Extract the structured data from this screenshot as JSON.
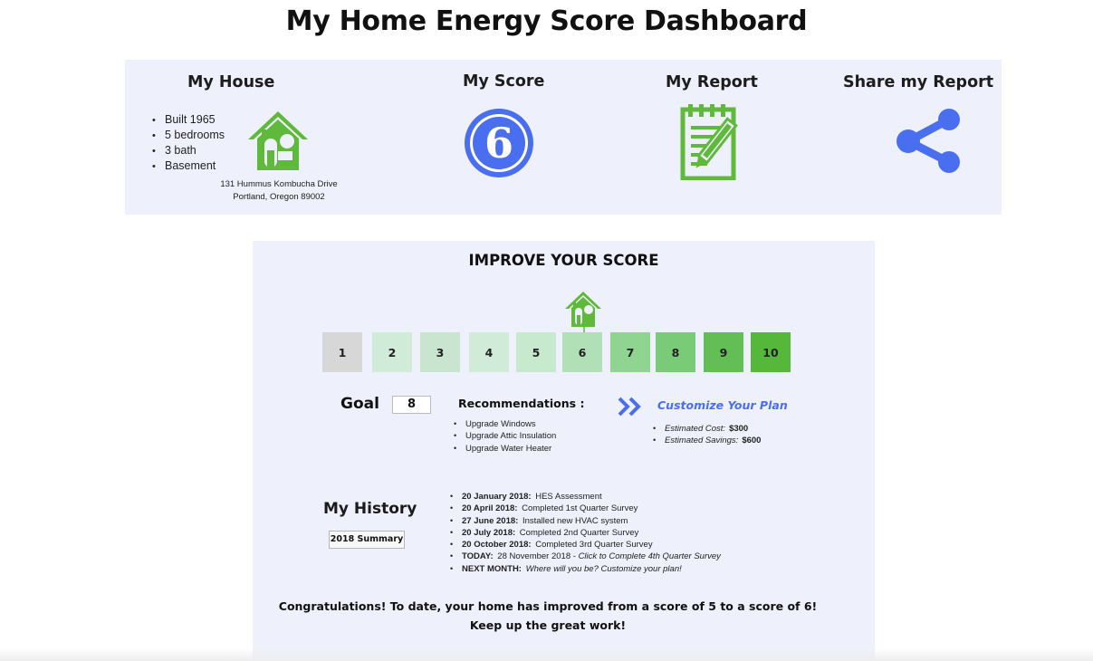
{
  "page": {
    "title": "My Home Energy Score Dashboard"
  },
  "house": {
    "heading": "My House",
    "facts": [
      "Built 1965",
      "5 bedrooms",
      "3 bath",
      "Basement"
    ],
    "address_line1": "131 Hummus  Kombucha Drive",
    "address_line2": "Portland, Oregon 89002",
    "icon": "house-icon"
  },
  "score": {
    "heading": "My Score",
    "value": "6",
    "icon": "score-badge-icon"
  },
  "report": {
    "heading": "My Report",
    "icon": "notepad-pencil-icon"
  },
  "share": {
    "heading": "Share my Report",
    "icon": "share-icon"
  },
  "improve": {
    "title": "IMPROVE YOUR SCORE",
    "scale": [
      "1",
      "2",
      "3",
      "4",
      "5",
      "6",
      "7",
      "8",
      "9",
      "10"
    ],
    "current_score": 6,
    "scale_colors": [
      "#d7d7d7",
      "#d0ebd8",
      "#c9e4cf",
      "#d0ebd8",
      "#c7e9ce",
      "#b2e0b6",
      "#90d491",
      "#7acb77",
      "#63bf55",
      "#55b83b"
    ],
    "goal_label": "Goal",
    "goal_value": "8",
    "recommendations_title": "Recommendations :",
    "recommendations": [
      "Upgrade Windows",
      "Upgrade Attic Insulation",
      "Upgrade Water Heater"
    ],
    "customize_label": "Customize Your Plan",
    "estimated_cost_label": "Estimated Cost:",
    "estimated_cost": "$300",
    "estimated_savings_label": "Estimated Savings:",
    "estimated_savings": "$600"
  },
  "history": {
    "heading": "My History",
    "summary_button": "2018 Summary",
    "entries": [
      {
        "date": "20 January 2018:",
        "text": " HES Assessment"
      },
      {
        "date": "20 April 2018:",
        "text": " Completed 1st Quarter Survey"
      },
      {
        "date": "27 June 2018:",
        "text": " Installed new HVAC system"
      },
      {
        "date": "20 July 2018:",
        "text": " Completed 2nd Quarter Survey"
      },
      {
        "date": "20 October 2018:",
        "text": " Completed 3rd Quarter Survey"
      },
      {
        "date": "TODAY:",
        "text": " 28 November 2018 - ",
        "italic": "Click to Complete 4th Quarter Survey"
      },
      {
        "date": "NEXT MONTH:",
        "text": " ",
        "italic": "Where will you be? Customize your plan!"
      }
    ]
  },
  "congrats": {
    "line1": "Congratulations! To date, your home has improved from a score of 5 to a score of 6!",
    "line2": "Keep up the great work!"
  },
  "colors": {
    "green": "#5fb93a",
    "blue": "#4a6ef0",
    "panel": "#eef0fb"
  }
}
